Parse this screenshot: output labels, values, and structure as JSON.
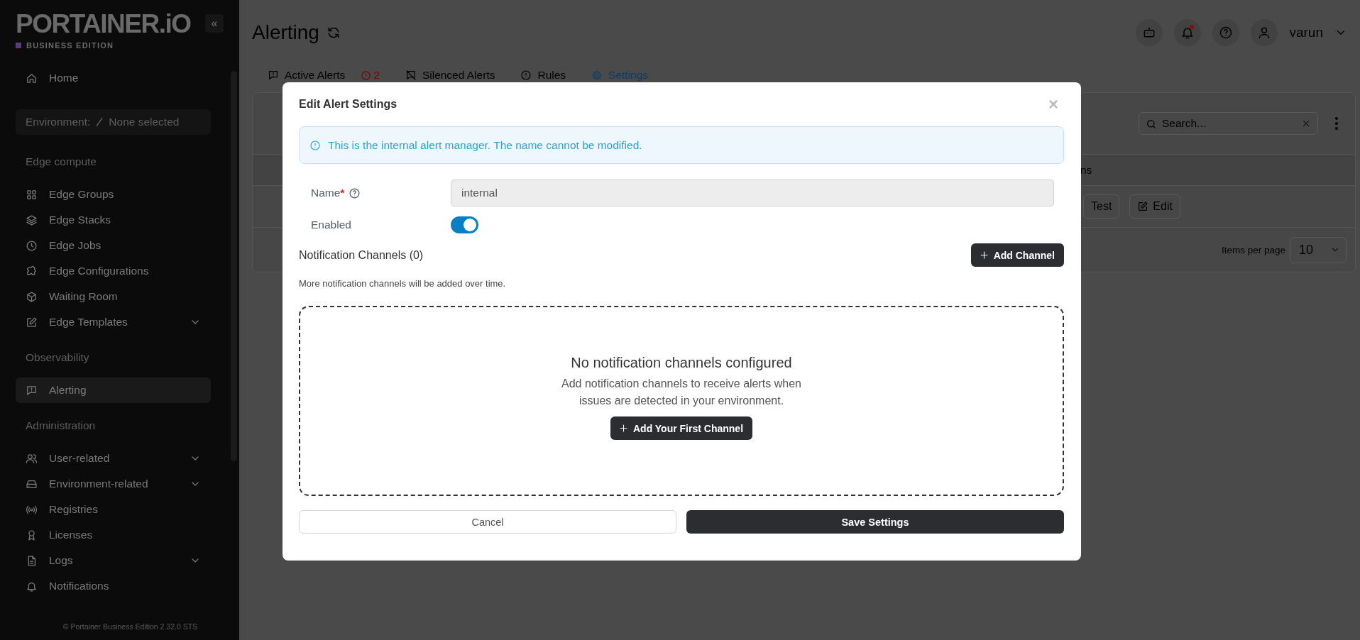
{
  "sidebar": {
    "logo": "PORTAINER.iO",
    "edition": "BUSINESS EDITION",
    "collapse": "«",
    "environment": {
      "label": "Environment:",
      "value": "None selected"
    },
    "nav": [
      {
        "kind": "item",
        "label": "Home",
        "selected": false,
        "expandable": false
      },
      {
        "kind": "heading",
        "label": "Edge compute"
      },
      {
        "kind": "item",
        "label": "Edge Groups",
        "selected": false,
        "expandable": false
      },
      {
        "kind": "item",
        "label": "Edge Stacks",
        "selected": false,
        "expandable": false
      },
      {
        "kind": "item",
        "label": "Edge Jobs",
        "selected": false,
        "expandable": false
      },
      {
        "kind": "item",
        "label": "Edge Configurations",
        "selected": false,
        "expandable": false
      },
      {
        "kind": "item",
        "label": "Waiting Room",
        "selected": false,
        "expandable": false
      },
      {
        "kind": "item",
        "label": "Edge Templates",
        "selected": false,
        "expandable": true
      },
      {
        "kind": "heading",
        "label": "Observability"
      },
      {
        "kind": "item",
        "label": "Alerting",
        "selected": true,
        "expandable": false
      },
      {
        "kind": "heading",
        "label": "Administration"
      },
      {
        "kind": "item",
        "label": "User-related",
        "selected": false,
        "expandable": true
      },
      {
        "kind": "item",
        "label": "Environment-related",
        "selected": false,
        "expandable": true
      },
      {
        "kind": "item",
        "label": "Registries",
        "selected": false,
        "expandable": false
      },
      {
        "kind": "item",
        "label": "Licenses",
        "selected": false,
        "expandable": false
      },
      {
        "kind": "item",
        "label": "Logs",
        "selected": false,
        "expandable": true
      },
      {
        "kind": "item",
        "label": "Notifications",
        "selected": false,
        "expandable": false
      }
    ],
    "footer": "© Portainer Business Edition 2.32.0 STS"
  },
  "header": {
    "title": "Alerting",
    "user": "varun",
    "unread_notifications": true
  },
  "tabs": [
    {
      "label": "Active Alerts",
      "selected": false,
      "badge": "2"
    },
    {
      "label": "Silenced Alerts",
      "selected": false
    },
    {
      "label": "Rules",
      "selected": false
    },
    {
      "label": "Settings",
      "selected": true
    }
  ],
  "table": {
    "search": {
      "placeholder": "Search..."
    },
    "column_heading": "ns",
    "row_actions": [
      "Test",
      "Edit"
    ],
    "items_per_page_label": "Items per page",
    "items_per_page": "10"
  },
  "modal": {
    "title": "Edit Alert Settings",
    "close": "×",
    "info": "This is the internal alert manager. The name cannot be modified.",
    "name": {
      "label": "Name",
      "required_mark": "*",
      "value": "internal",
      "disabled": true
    },
    "enabled": {
      "label": "Enabled",
      "on": true
    },
    "channels_heading": "Notification Channels (0)",
    "add_channel": "Add Channel",
    "hint": "More notification channels will be added over time.",
    "empty": {
      "title": "No notification channels configured",
      "text": "Add notification channels to receive alerts when issues are detected in your environment.",
      "button": "Add Your First Channel"
    },
    "buttons": {
      "cancel": "Cancel",
      "save": "Save Settings"
    }
  }
}
